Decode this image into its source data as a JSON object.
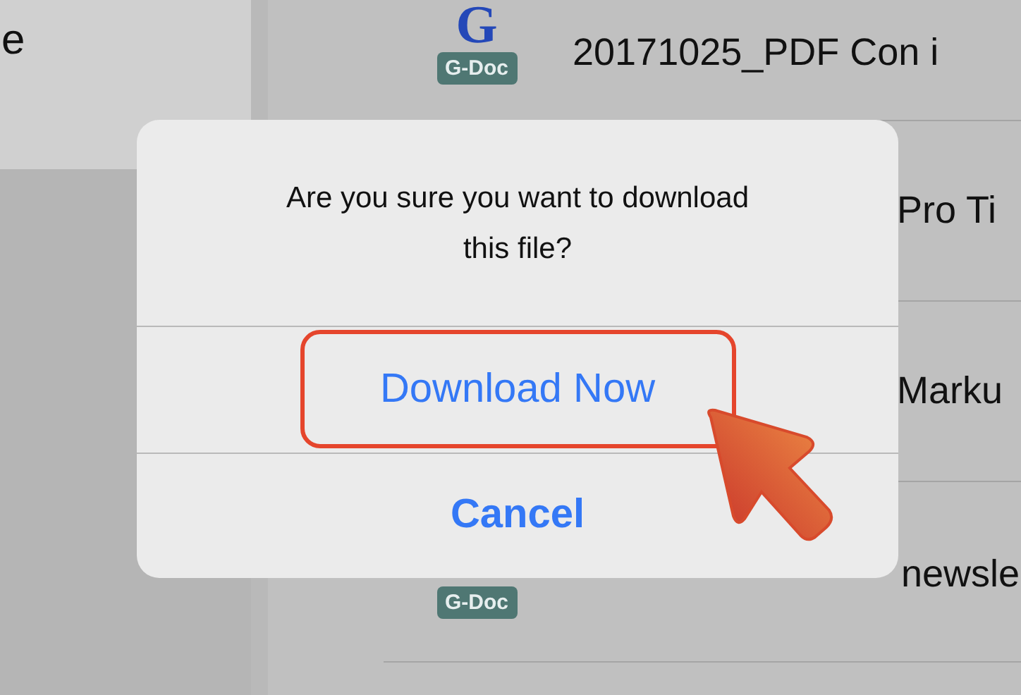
{
  "sidebar": {
    "item_label": "e"
  },
  "files": [
    {
      "name": "20171025_PDF Con i",
      "icon_glyph": "G",
      "icon_label": "G-Doc",
      "covered": false
    },
    {
      "name": "Pro Ti",
      "covered": true
    },
    {
      "name": "Marku",
      "covered": true
    },
    {
      "name": "newsle",
      "icon_label": "G-Doc",
      "covered": true
    }
  ],
  "dialog": {
    "message": "Are you sure you want to download this file?",
    "actions": [
      {
        "label": "Download Now",
        "highlighted": true,
        "bold": false
      },
      {
        "label": "Cancel",
        "highlighted": false,
        "bold": true
      }
    ]
  }
}
